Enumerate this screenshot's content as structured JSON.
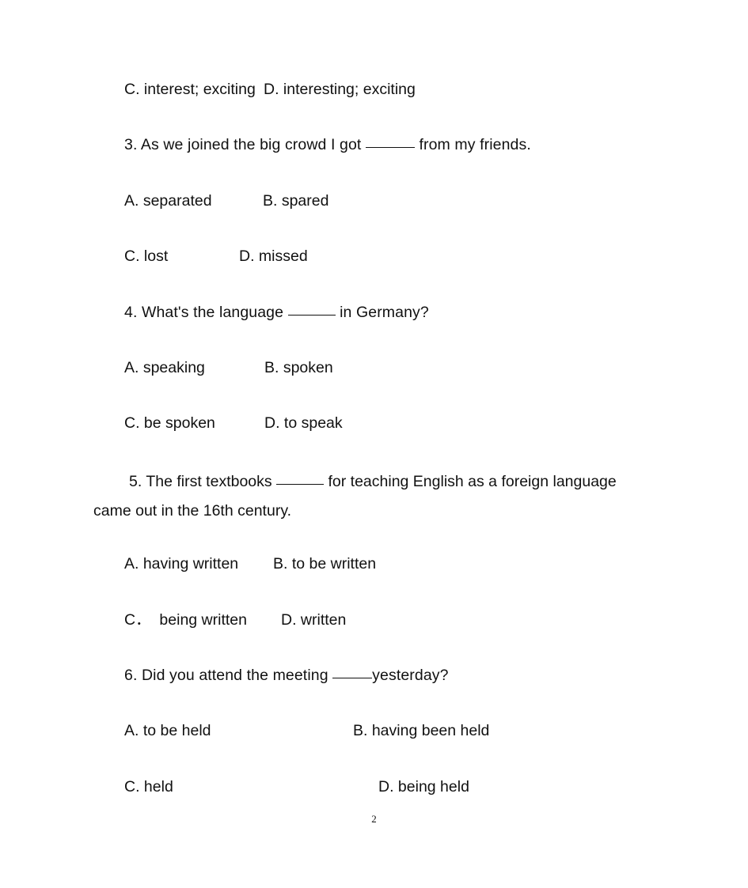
{
  "document": {
    "type": "grammar-worksheet",
    "page_number": "2",
    "background_color": "#ffffff",
    "text_color": "#111111"
  },
  "carryover_options": {
    "c_label": "C. interest; exciting",
    "d_label": "D. interesting; exciting"
  },
  "questions": [
    {
      "number": "3",
      "stem_before": "3. As we joined the big crowd I got ",
      "stem_after": " from my friends.",
      "blank_width": "w-long",
      "options": [
        {
          "key": "A",
          "label": "A. separated"
        },
        {
          "key": "B",
          "label": "B. spared"
        },
        {
          "key": "C",
          "label": "C. lost"
        },
        {
          "key": "D",
          "label": "D. missed"
        }
      ]
    },
    {
      "number": "4",
      "stem_before": "4. What's the language ",
      "stem_after": " in Germany?",
      "blank_width": "w-med",
      "options": [
        {
          "key": "A",
          "label": "A. speaking"
        },
        {
          "key": "B",
          "label": "B. spoken"
        },
        {
          "key": "C",
          "label": "C. be spoken"
        },
        {
          "key": "D",
          "label": "D. to speak"
        }
      ]
    },
    {
      "number": "5",
      "stem_before": "5. The first textbooks ",
      "stem_after": " for teaching English as a foreign language came out in the 16th century.",
      "blank_width": "w-med",
      "options": [
        {
          "key": "A",
          "label": "A. having written"
        },
        {
          "key": "B",
          "label": "B. to be written"
        },
        {
          "key": "C",
          "label": "C．  being written"
        },
        {
          "key": "D",
          "label": "D. written"
        }
      ]
    },
    {
      "number": "6",
      "stem_before": "6. Did you attend the meeting ",
      "stem_after": "yesterday?",
      "blank_width": "w-short",
      "options": [
        {
          "key": "A",
          "label": "A. to be held"
        },
        {
          "key": "B",
          "label": "B. having been held"
        },
        {
          "key": "C",
          "label": "C. held"
        },
        {
          "key": "D",
          "label": "D. being held"
        }
      ]
    }
  ]
}
